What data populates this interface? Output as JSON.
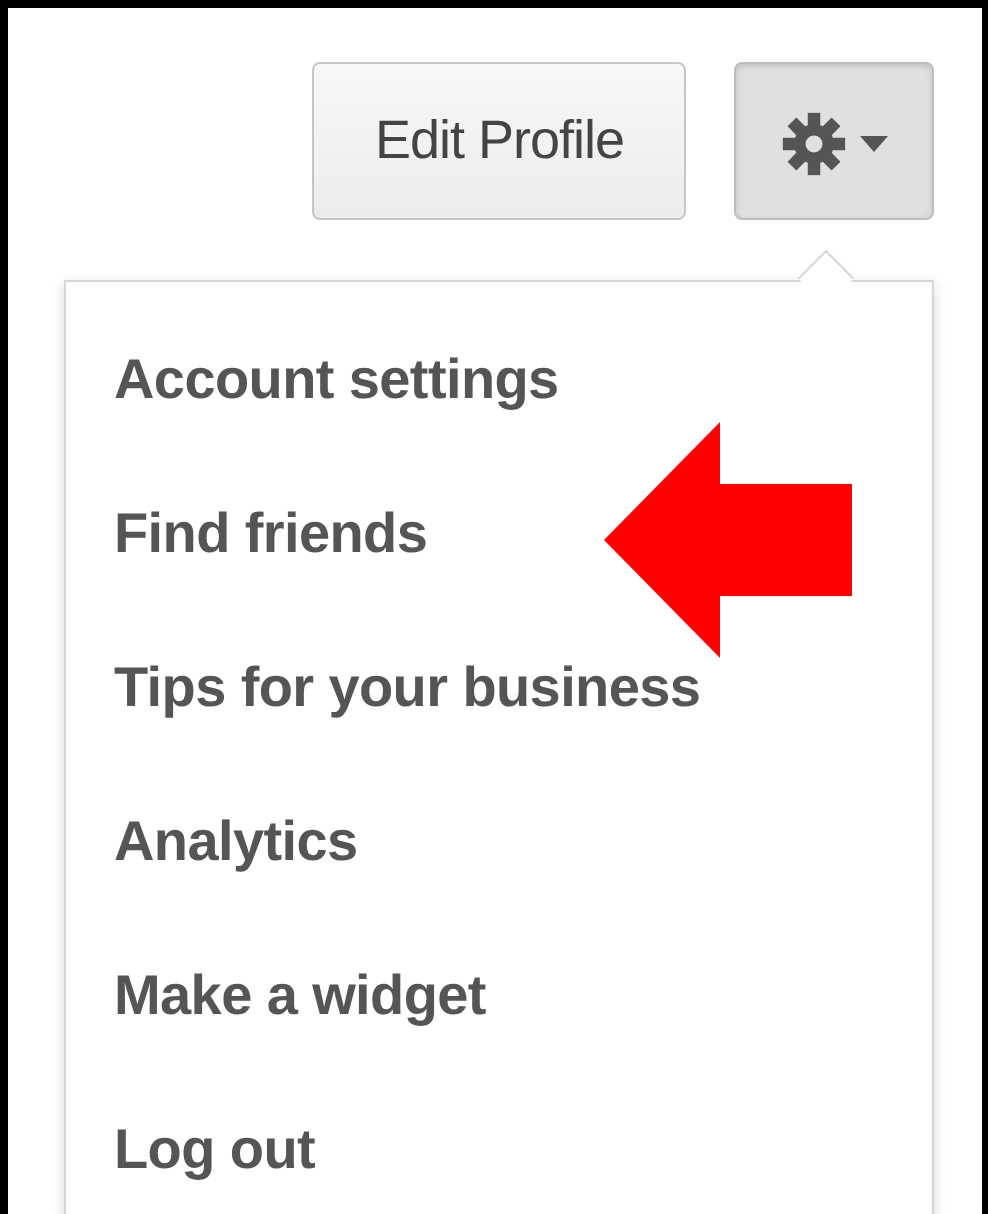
{
  "buttons": [
    {
      "kind": "text",
      "label": "Edit Profile",
      "active": false
    },
    {
      "kind": "gear",
      "active": true
    }
  ],
  "menu": {
    "open": true,
    "items": [
      {
        "label": "Account settings",
        "marked": false
      },
      {
        "label": "Find friends",
        "marked": true
      },
      {
        "label": "Tips for your business",
        "marked": false
      },
      {
        "label": "Analytics",
        "marked": false
      },
      {
        "label": "Make a widget",
        "marked": false
      },
      {
        "label": "Log out",
        "marked": false
      }
    ]
  }
}
